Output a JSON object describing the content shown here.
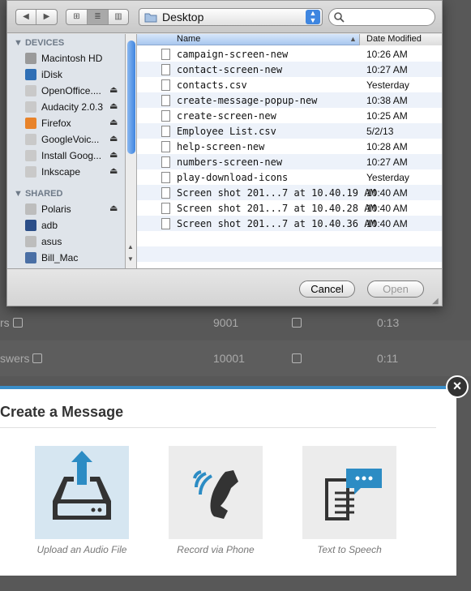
{
  "dialog": {
    "location": "Desktop",
    "sidebar": {
      "devices_header": "DEVICES",
      "devices": [
        {
          "label": "Macintosh HD",
          "eject": false
        },
        {
          "label": "iDisk",
          "eject": false
        },
        {
          "label": "OpenOffice....",
          "eject": true
        },
        {
          "label": "Audacity 2.0.3",
          "eject": true
        },
        {
          "label": "Firefox",
          "eject": true
        },
        {
          "label": "GoogleVoic...",
          "eject": true
        },
        {
          "label": "Install Goog...",
          "eject": true
        },
        {
          "label": "Inkscape",
          "eject": true
        }
      ],
      "shared_header": "SHARED",
      "shared": [
        {
          "label": "Polaris",
          "eject": true
        },
        {
          "label": "adb",
          "eject": false
        },
        {
          "label": "asus",
          "eject": false
        },
        {
          "label": "Bill_Mac",
          "eject": false
        }
      ]
    },
    "columns": {
      "name": "Name",
      "date": "Date Modified"
    },
    "files": [
      {
        "name": "campaign-screen-new",
        "date": "10:26 AM"
      },
      {
        "name": "contact-screen-new",
        "date": "10:27 AM"
      },
      {
        "name": "contacts.csv",
        "date": "Yesterday"
      },
      {
        "name": "create-message-popup-new",
        "date": "10:38 AM"
      },
      {
        "name": "create-screen-new",
        "date": "10:25 AM"
      },
      {
        "name": "Employee List.csv",
        "date": "5/2/13"
      },
      {
        "name": "help-screen-new",
        "date": "10:28 AM"
      },
      {
        "name": "numbers-screen-new",
        "date": "10:27 AM"
      },
      {
        "name": "play-download-icons",
        "date": "Yesterday"
      },
      {
        "name": "Screen shot 201...7 at 10.40.19 AM",
        "date": "10:40 AM"
      },
      {
        "name": "Screen shot 201...7 at 10.40.28 AM",
        "date": "10:40 AM"
      },
      {
        "name": "Screen shot 201...7 at 10.40.36 AM",
        "date": "10:40 AM"
      }
    ],
    "cancel_label": "Cancel",
    "open_label": "Open"
  },
  "background": {
    "rows": [
      {
        "name": "rs",
        "number": "9001",
        "time": "0:13"
      },
      {
        "name": "swers",
        "number": "10001",
        "time": "0:11"
      }
    ]
  },
  "modal": {
    "title": "Create a Message",
    "options": [
      {
        "label": "Upload an Audio File"
      },
      {
        "label": "Record via Phone"
      },
      {
        "label": "Text to Speech"
      }
    ],
    "close_symbol": "×"
  },
  "colors": {
    "accent": "#3a8ec9",
    "icon_dark": "#333333",
    "icon_blue": "#2c8cc4"
  }
}
